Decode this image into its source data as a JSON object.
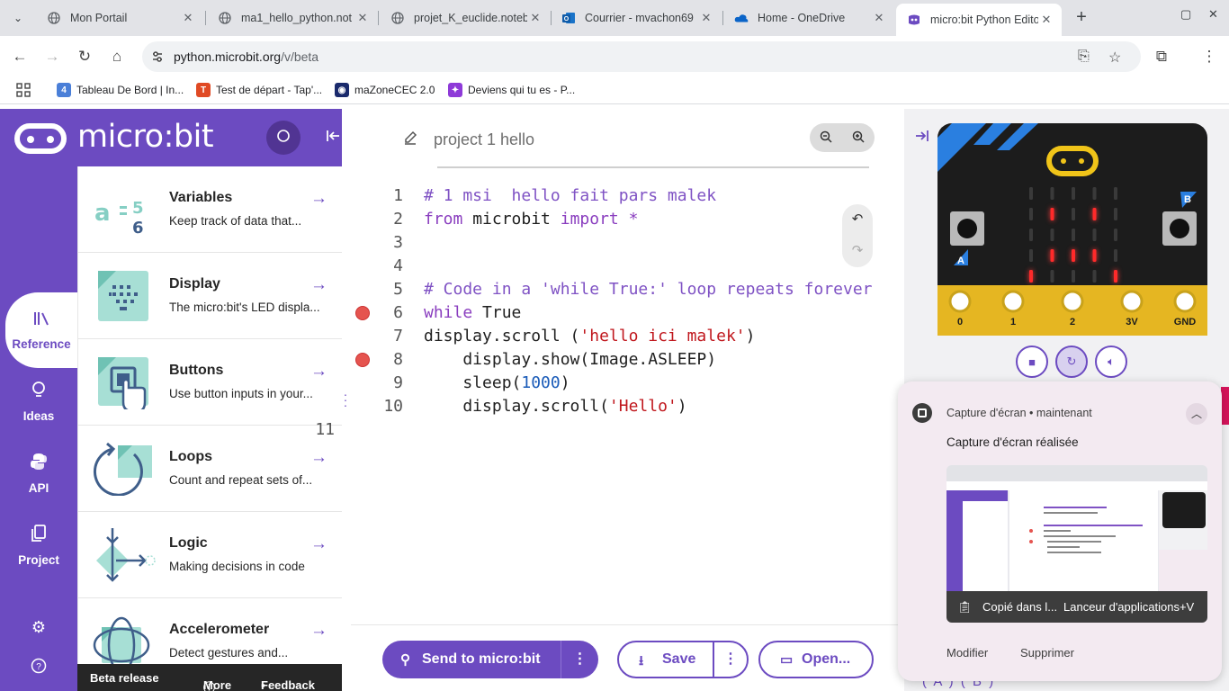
{
  "browser": {
    "tabs": [
      {
        "title": "Mon Portail",
        "icon": "globe-icon",
        "active": false
      },
      {
        "title": "ma1_hello_python.not",
        "icon": "globe-icon",
        "active": false
      },
      {
        "title": "projet_K_euclide.noteb",
        "icon": "globe-icon",
        "active": false
      },
      {
        "title": "Courrier - mvachon69",
        "icon": "outlook-icon",
        "active": false
      },
      {
        "title": "Home - OneDrive",
        "icon": "onedrive-icon",
        "active": false
      },
      {
        "title": "micro:bit Python Edito",
        "icon": "microbit-icon",
        "active": true
      }
    ],
    "url_host": "python.microbit.org",
    "url_path": "/v/beta",
    "bookmarks": [
      {
        "label": "Tableau De Bord | In...",
        "icon_text": "4",
        "color": "#4a7fd8"
      },
      {
        "label": "Test de départ - Tap'...",
        "icon_text": "T",
        "color": "#e04a24"
      },
      {
        "label": "maZoneCEC 2.0",
        "icon_text": "◉",
        "color": "#1a2a6c"
      },
      {
        "label": "Deviens qui tu es - P...",
        "icon_text": "✦",
        "color": "#8e3ad8"
      }
    ]
  },
  "app": {
    "brand": "micro:bit",
    "accent": "#6c4bc1",
    "rail": {
      "reference": "Reference",
      "ideas": "Ideas",
      "api": "API",
      "project": "Project"
    },
    "reference_items": [
      {
        "title": "Variables",
        "desc": "Keep track of data that..."
      },
      {
        "title": "Display",
        "desc": "The micro:bit's LED displa..."
      },
      {
        "title": "Buttons",
        "desc": "Use button inputs in your..."
      },
      {
        "title": "Loops",
        "desc": "Count and repeat sets of..."
      },
      {
        "title": "Logic",
        "desc": "Making decisions in code"
      },
      {
        "title": "Accelerometer",
        "desc": "Detect gestures and..."
      }
    ],
    "footer": {
      "beta": "Beta release",
      "more": "More",
      "feedback": "Feedback"
    },
    "project_name": "project 1 hello",
    "code_lines": [
      {
        "n": "1",
        "text": "# 1 msi  hello fait pars malek"
      },
      {
        "n": "2",
        "text": "from microbit import *"
      },
      {
        "n": "3",
        "text": ""
      },
      {
        "n": "4",
        "text": ""
      },
      {
        "n": "5",
        "text": "# Code in a 'while True:' loop repeats forever"
      },
      {
        "n": "6",
        "text": "while True"
      },
      {
        "n": "7",
        "text": "display.scroll ('hello ici malek')"
      },
      {
        "n": "8",
        "text": "    display.show(Image.ASLEEP)"
      },
      {
        "n": "9",
        "text": "    sleep(1000)"
      },
      {
        "n": "10",
        "text": "    display.scroll('Hello')"
      },
      {
        "n": "11",
        "text": ""
      }
    ],
    "breakpoint_lines": [
      "6",
      "8"
    ],
    "actions": {
      "send": "Send to micro:bit",
      "save": "Save",
      "open": "Open..."
    },
    "simulator": {
      "pins": [
        "0",
        "1",
        "2",
        "3V",
        "GND"
      ],
      "button_a": "A",
      "button_b": "B",
      "led_on": [
        [
          0,
          0,
          0,
          0,
          0
        ],
        [
          0,
          1,
          0,
          1,
          0
        ],
        [
          0,
          0,
          0,
          0,
          0
        ],
        [
          0,
          1,
          1,
          1,
          0
        ],
        [
          1,
          0,
          0,
          0,
          1
        ]
      ],
      "bottom_label": "( A ) ( B )"
    }
  },
  "notification": {
    "app": "Capture d'écran",
    "time": "maintenant",
    "title": "Capture d'écran réalisée",
    "copy_text": "Copié dans l...",
    "copy_shortcut": "Lanceur d'applications+V",
    "modify": "Modifier",
    "delete": "Supprimer"
  }
}
